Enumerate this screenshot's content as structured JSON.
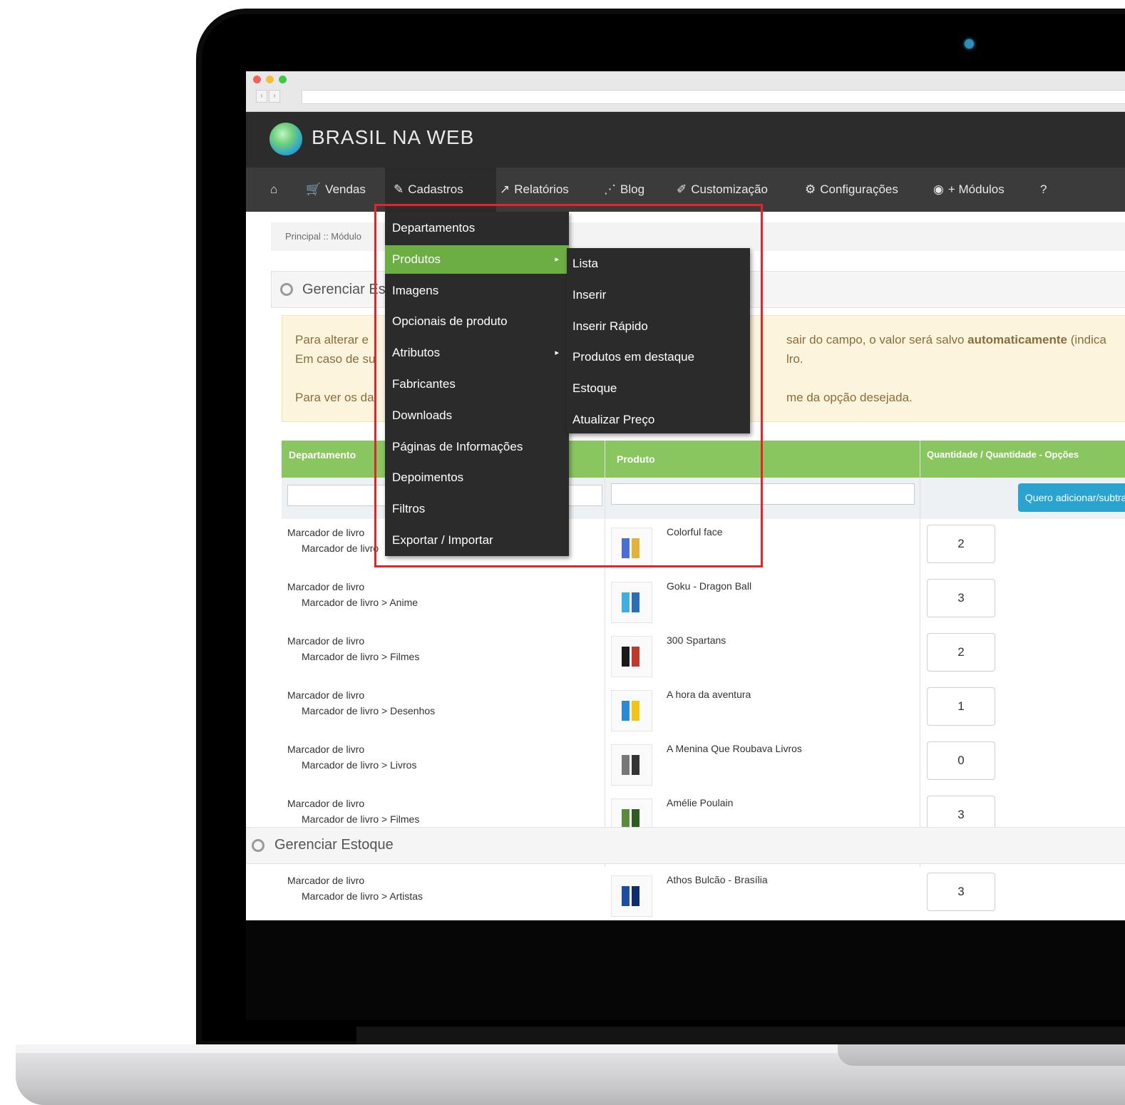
{
  "app": {
    "brand": "BRASIL NA WEB"
  },
  "nav": [
    {
      "icon": "home-icon",
      "label": ""
    },
    {
      "icon": "cart-icon",
      "label": "Vendas"
    },
    {
      "icon": "edit-icon",
      "label": "Cadastros"
    },
    {
      "icon": "chart-icon",
      "label": "Relatórios"
    },
    {
      "icon": "rss-icon",
      "label": "Blog"
    },
    {
      "icon": "brush-icon",
      "label": "Customização"
    },
    {
      "icon": "gear-icon",
      "label": "Configurações"
    },
    {
      "icon": "globe-icon",
      "label": "+ Módulos"
    },
    {
      "icon": "help-icon",
      "label": ""
    }
  ],
  "breadcrumb": "Principal :: Módulo",
  "panel": {
    "title": "Gerenciar Es",
    "title_bottom": "Gerenciar Estoque"
  },
  "alert": {
    "line1_left": "Para alterar e",
    "line1_right_pre": "sair do campo, o valor será salvo ",
    "line1_right_bold": "automaticamente",
    "line1_right_post": " (indica",
    "line2_left": "Em caso de su",
    "line2_right": "lro.",
    "line3_left": "Para ver os da",
    "line3_right": "me da opção desejada."
  },
  "table": {
    "headers": {
      "department": "Departamento",
      "product": "Produto",
      "quantity": "Quantidade / Quantidade - Opções"
    },
    "add_button": "Quero adicionar/subtrair",
    "rows": [
      {
        "dept": "Marcador de livro",
        "sub": "Marcador de livro",
        "product": "Colorful face",
        "qty": "2"
      },
      {
        "dept": "Marcador de livro",
        "sub": "Marcador de livro > Anime",
        "product": "Goku - Dragon Ball",
        "qty": "3"
      },
      {
        "dept": "Marcador de livro",
        "sub": "Marcador de livro > Filmes",
        "product": "300 Spartans",
        "qty": "2"
      },
      {
        "dept": "Marcador de livro",
        "sub": "Marcador de livro > Desenhos",
        "product": "A hora da aventura",
        "qty": "1"
      },
      {
        "dept": "Marcador de livro",
        "sub": "Marcador de livro > Livros",
        "product": "A Menina Que Roubava Livros",
        "qty": "0"
      },
      {
        "dept": "Marcador de livro",
        "sub": "Marcador de livro > Filmes",
        "product": "Amélie Poulain",
        "qty": "3"
      },
      {
        "dept": "Marcador de livro",
        "sub": "Marcador de livro > Artistas",
        "product": "Athos Bulcão - Brasília",
        "qty": "3"
      }
    ]
  },
  "menu": {
    "items": [
      "Departamentos",
      "Produtos",
      "Imagens",
      "Opcionais de produto",
      "Atributos",
      "Fabricantes",
      "Downloads",
      "Páginas de Informações",
      "Depoimentos",
      "Filtros",
      "Exportar / Importar"
    ],
    "submenu": [
      "Lista",
      "Inserir",
      "Inserir Rápido",
      "Produtos em destaque",
      "Estoque",
      "Atualizar Preço"
    ]
  },
  "colors": {
    "accent_green": "#8ac65f",
    "menu_active": "#6cae43",
    "button_blue": "#2aa4cf",
    "highlight_red": "#e0262b"
  }
}
